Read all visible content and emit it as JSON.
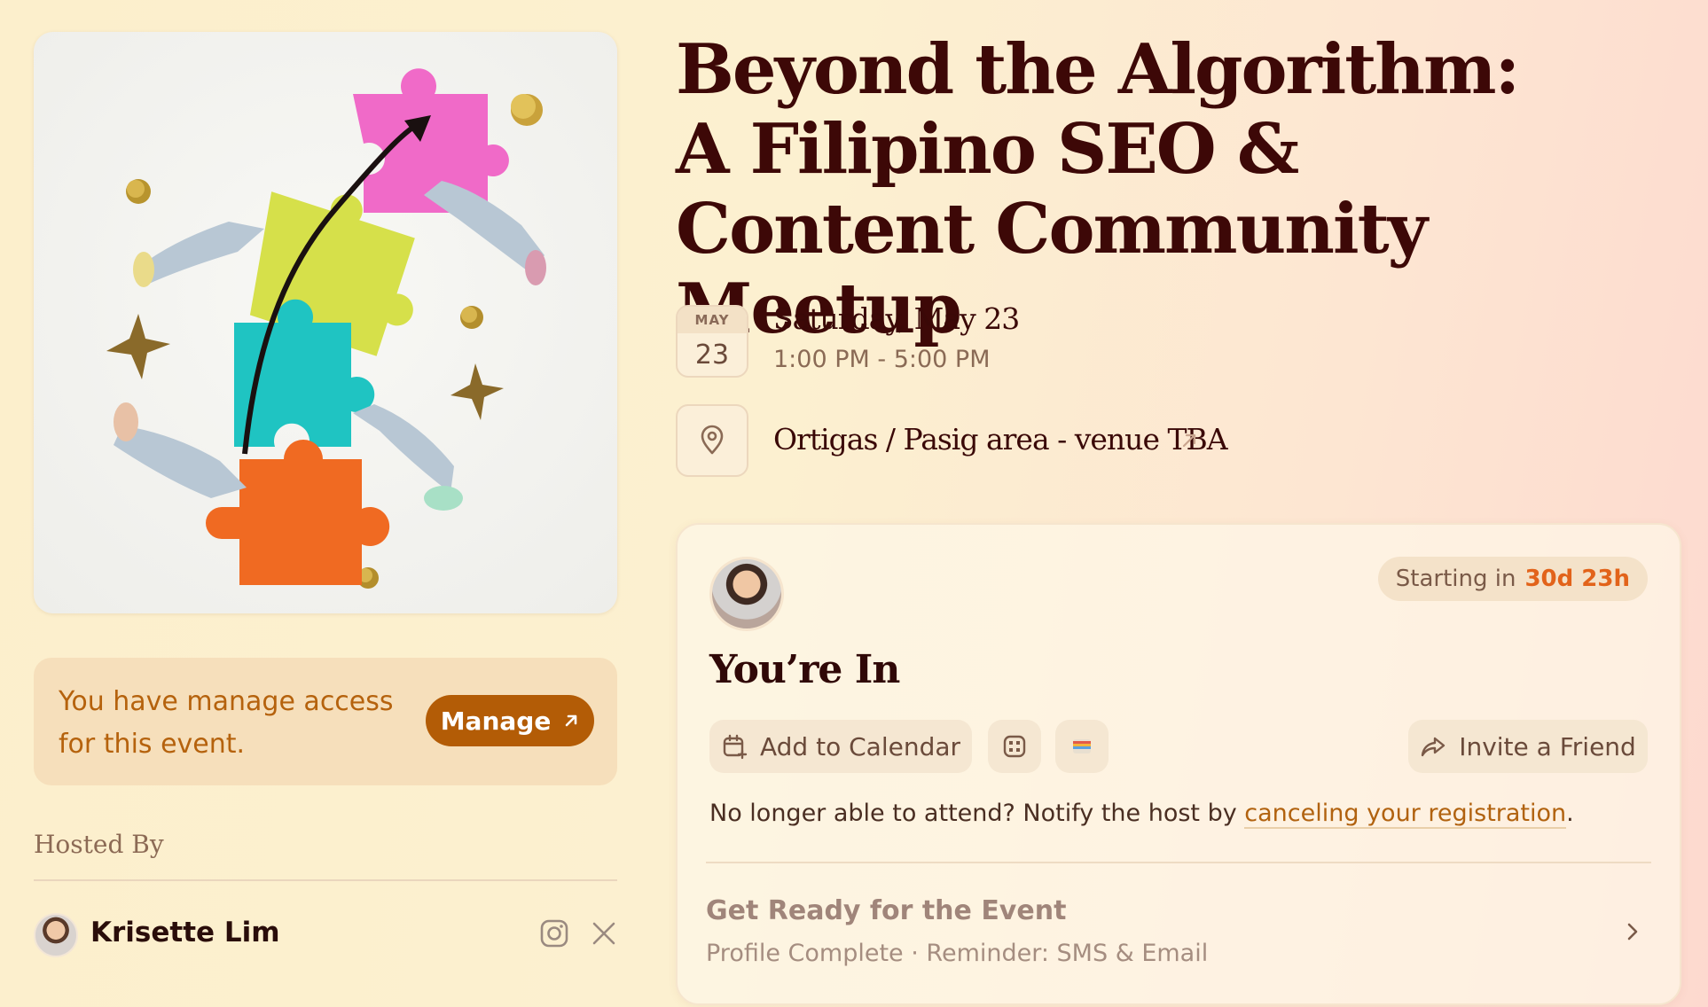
{
  "event": {
    "title": "Beyond the Algorithm: A Filipino SEO & Content Community Meetup",
    "date_month": "MAY",
    "date_day": "23",
    "date_full": "Saturday, May 23",
    "time_range": "1:00 PM - 5:00 PM",
    "location": "Ortigas / Pasig area - venue TBA"
  },
  "manage": {
    "text": "You have manage access for this event.",
    "button_label": "Manage"
  },
  "host": {
    "section_label": "Hosted By",
    "name": "Krisette Lim"
  },
  "rsvp": {
    "countdown_prefix": "Starting in",
    "countdown_value": "30d 23h",
    "status": "You’re In",
    "add_to_calendar": "Add to Calendar",
    "invite_friend": "Invite a Friend",
    "cancel_prefix": "No longer able to attend? Notify the host by ",
    "cancel_link": "canceling your registration",
    "cancel_suffix": ".",
    "ready_title": "Get Ready for the Event",
    "ready_sub": "Profile Complete · Reminder: SMS & Email"
  },
  "colors": {
    "accent": "#b35c06",
    "title": "#3d0807",
    "countdown_highlight": "#e2631a"
  },
  "icons": [
    "map-pin-icon",
    "external-arrow-icon",
    "calendar-add-icon",
    "qr-code-icon",
    "wallet-icon",
    "share-icon",
    "chevron-right-icon",
    "instagram-icon",
    "x-icon"
  ]
}
